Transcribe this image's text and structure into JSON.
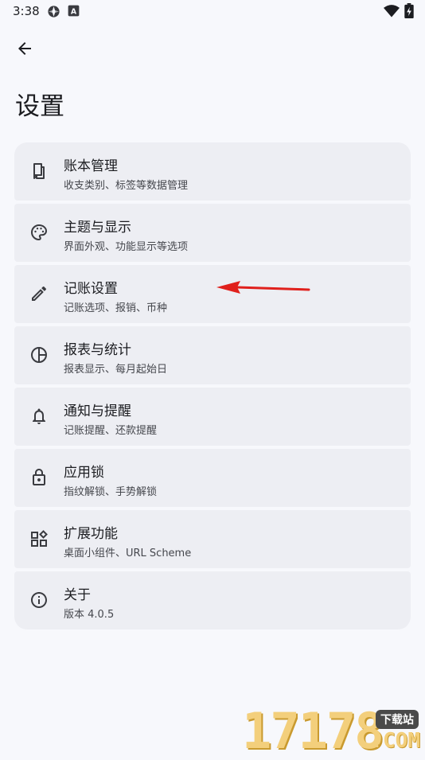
{
  "status_bar": {
    "time": "3:38",
    "icons": [
      "sync-icon",
      "a-notification-icon",
      "wifi-icon",
      "battery-charging-icon"
    ]
  },
  "header": {
    "back_icon": "arrow-left-icon",
    "title": "设置"
  },
  "settings": [
    {
      "icon": "ledger-book-icon",
      "title": "账本管理",
      "subtitle": "收支类别、标签等数据管理"
    },
    {
      "icon": "palette-icon",
      "title": "主题与显示",
      "subtitle": "界面外观、功能显示等选项"
    },
    {
      "icon": "pencil-icon",
      "title": "记账设置",
      "subtitle": "记账选项、报销、币种"
    },
    {
      "icon": "pie-chart-icon",
      "title": "报表与统计",
      "subtitle": "报表显示、每月起始日"
    },
    {
      "icon": "bell-icon",
      "title": "通知与提醒",
      "subtitle": "记账提醒、还款提醒"
    },
    {
      "icon": "lock-icon",
      "title": "应用锁",
      "subtitle": "指纹解锁、手势解锁"
    },
    {
      "icon": "widgets-icon",
      "title": "扩展功能",
      "subtitle": "桌面小组件、URL Scheme"
    },
    {
      "icon": "info-icon",
      "title": "关于",
      "subtitle": "版本 4.0.5"
    }
  ],
  "annotation": {
    "icon": "red-arrow-icon",
    "color": "#e0201c"
  },
  "watermark": {
    "digits": "17178",
    "badge": "下载站",
    "domain": ".COM"
  }
}
